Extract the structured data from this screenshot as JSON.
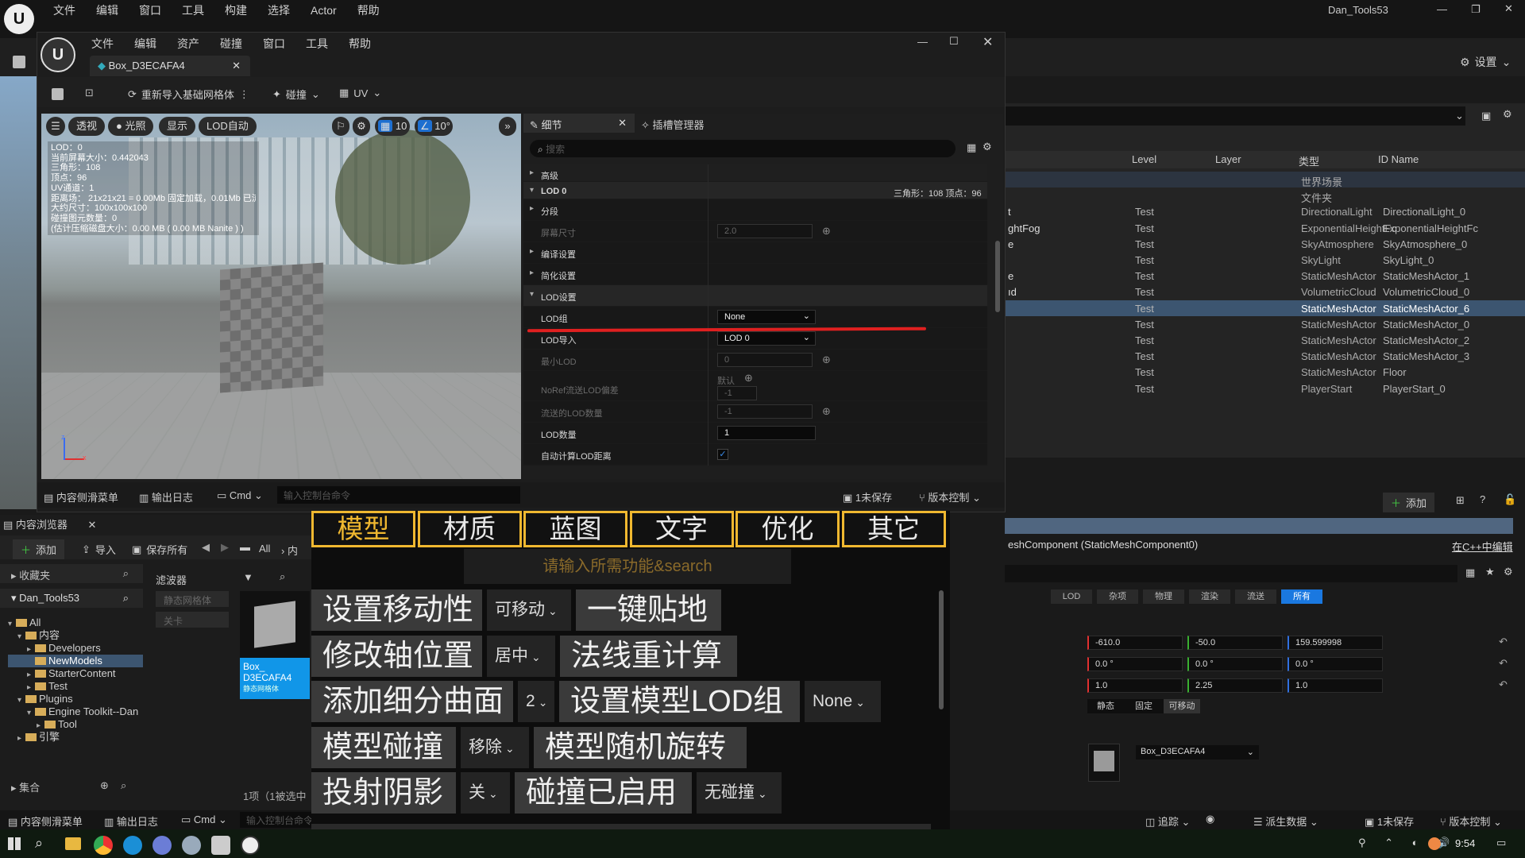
{
  "main_menu": [
    "文件",
    "编辑",
    "窗口",
    "工具",
    "构建",
    "选择",
    "Actor",
    "帮助"
  ],
  "window_title": "Dan_Tools53",
  "settings_label": "设置",
  "outliner": {
    "columns": [
      "Level",
      "Layer",
      "类型",
      "ID Name"
    ],
    "rows": [
      {
        "name": "",
        "level": "",
        "type": "世界场景",
        "id": ""
      },
      {
        "name": "",
        "level": "",
        "type": "文件夹",
        "id": ""
      },
      {
        "name": "t",
        "level": "Test",
        "type": "DirectionalLight",
        "id": "DirectionalLight_0"
      },
      {
        "name": "ghtFog",
        "level": "Test",
        "type": "ExponentialHeightFc",
        "id": "ExponentialHeightFc"
      },
      {
        "name": "e",
        "level": "Test",
        "type": "SkyAtmosphere",
        "id": "SkyAtmosphere_0"
      },
      {
        "name": "",
        "level": "Test",
        "type": "SkyLight",
        "id": "SkyLight_0"
      },
      {
        "name": "e",
        "level": "Test",
        "type": "StaticMeshActor",
        "id": "StaticMeshActor_1"
      },
      {
        "name": "ıd",
        "level": "Test",
        "type": "VolumetricCloud",
        "id": "VolumetricCloud_0"
      },
      {
        "name": "",
        "level": "Test",
        "type": "StaticMeshActor",
        "id": "StaticMeshActor_6"
      },
      {
        "name": "",
        "level": "Test",
        "type": "StaticMeshActor",
        "id": "StaticMeshActor_0"
      },
      {
        "name": "",
        "level": "Test",
        "type": "StaticMeshActor",
        "id": "StaticMeshActor_2"
      },
      {
        "name": "",
        "level": "Test",
        "type": "StaticMeshActor",
        "id": "StaticMeshActor_3"
      },
      {
        "name": "",
        "level": "Test",
        "type": "StaticMeshActor",
        "id": "Floor"
      },
      {
        "name": "",
        "level": "Test",
        "type": "PlayerStart",
        "id": "PlayerStart_0"
      }
    ]
  },
  "details_right": {
    "add_label": "添加",
    "component_text": "eshComponent (StaticMeshComponent0)",
    "edit_cpp": "在C++中编辑",
    "filters": [
      "LOD",
      "杂项",
      "物理",
      "渲染",
      "流送",
      "所有"
    ],
    "location": [
      "-610.0",
      "-50.0",
      "159.599998"
    ],
    "rotation": [
      "0.0 °",
      "0.0 °",
      "0.0 °"
    ],
    "scale": [
      "1.0",
      "2.25",
      "1.0"
    ],
    "mobility": [
      "静态",
      "固定",
      "可移动"
    ],
    "mesh_name": "Box_D3ECAFA4"
  },
  "editor": {
    "menu": [
      "文件",
      "编辑",
      "资产",
      "碰撞",
      "窗口",
      "工具",
      "帮助"
    ],
    "tab_name": "Box_D3ECAFA4",
    "toolbar": {
      "reimport": "重新导入基础网格体",
      "collision": "碰撞",
      "uv": "UV"
    },
    "viewport": {
      "pills": [
        "透视",
        "光照",
        "显示",
        "LOD自动"
      ],
      "grid_val": "10",
      "angle_val": "10°",
      "stats": [
        "LOD：0",
        "当前屏幕大小：0.442043",
        "三角形：108",
        "顶点：96",
        "UV通道：1",
        "距离场：  21x21x21 = 0.00Mb 固定加载，0.01Mb 已流送",
        "大约尺寸：100x100x100",
        "碰撞图元数量：0",
        "(估计压缩磁盘大小：0.00 MB ( 0.00 MB Nanite ) )"
      ]
    },
    "details": {
      "tab": "细节",
      "tab2": "插槽管理器",
      "search_placeholder": "搜索",
      "advanced": "高级",
      "lod0": "LOD 0",
      "lod0_info": "三角形：108   顶点：96",
      "sections": "分段",
      "screen_size_label": "屏幕尺寸",
      "screen_size": "2.0",
      "build_settings": "编译设置",
      "reduction": "简化设置",
      "lod_settings": "LOD设置",
      "lod_group_label": "LOD组",
      "lod_group": "None",
      "lod_import_label": "LOD导入",
      "lod_import": "LOD 0",
      "min_lod_label": "最小LOD",
      "min_lod": "0",
      "noref_label": "NoRef流送LOD偏差",
      "noref_default": "默认",
      "noref_val": "-1",
      "streamed_label": "流送的LOD数量",
      "streamed_val": "-1",
      "lod_count_label": "LOD数量",
      "lod_count": "1",
      "auto_lod_label": "自动计算LOD距离"
    },
    "bottom": {
      "drawer": "内容侧滑菜单",
      "log": "输出日志",
      "cmd": "Cmd",
      "console_placeholder": "输入控制台命令",
      "unsaved": "1未保存",
      "source_control": "版本控制"
    }
  },
  "content_browser": {
    "tab": "内容浏览器",
    "add": "添加",
    "import": "导入",
    "save_all": "保存所有",
    "all": "All",
    "crumb": "内",
    "favorites": "收藏夹",
    "project": "Dan_Tools53",
    "tree": [
      "All",
      "内容",
      "Developers",
      "NewModels",
      "StarterContent",
      "Test",
      "Plugins",
      "Engine Toolkit--Dan",
      "Tool",
      "引擎"
    ],
    "filter_title": "滤波器",
    "filters": [
      "静态网格体",
      "关卡"
    ],
    "asset_name": "Box_\nD3ECAFA4",
    "asset_type": "静态网格体",
    "count": "1项（1被选中",
    "collections": "集合"
  },
  "tool_panel": {
    "tabs": [
      "模型",
      "材质",
      "蓝图",
      "文字",
      "优化",
      "其它"
    ],
    "search_placeholder": "请输入所需功能&search",
    "rows": [
      [
        {
          "t": "btn",
          "v": "设置移动性"
        },
        {
          "t": "dd",
          "v": "可移动"
        },
        {
          "t": "btn",
          "v": "一键贴地"
        }
      ],
      [
        {
          "t": "btn",
          "v": "修改轴位置"
        },
        {
          "t": "dd",
          "v": "居中"
        },
        {
          "t": "btn",
          "v": "法线重计算"
        }
      ],
      [
        {
          "t": "btn",
          "v": "添加细分曲面"
        },
        {
          "t": "dd",
          "v": "2"
        },
        {
          "t": "btn",
          "v": "设置模型LOD组"
        },
        {
          "t": "dd",
          "v": "None"
        }
      ],
      [
        {
          "t": "btn",
          "v": "模型碰撞"
        },
        {
          "t": "dd",
          "v": "移除"
        },
        {
          "t": "btn",
          "v": "模型随机旋转"
        }
      ],
      [
        {
          "t": "btn",
          "v": "投射阴影"
        },
        {
          "t": "dd",
          "v": "关"
        },
        {
          "t": "btn",
          "v": "碰撞已启用"
        },
        {
          "t": "dd",
          "v": "无碰撞"
        }
      ]
    ]
  },
  "status_bar": {
    "drawer": "内容侧滑菜单",
    "log": "输出日志",
    "cmd": "Cmd",
    "console_placeholder": "输入控制台命令",
    "trace": "追踪",
    "derived": "派生数据",
    "unsaved": "1未保存",
    "source_control": "版本控制"
  },
  "taskbar": {
    "time": "9:54"
  }
}
